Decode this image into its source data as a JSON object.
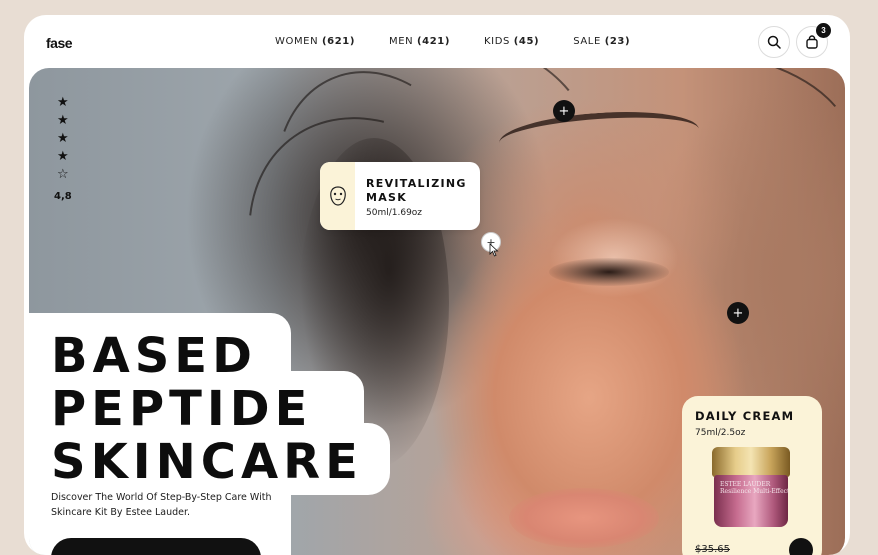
{
  "brand": {
    "logo": "fase"
  },
  "nav": [
    {
      "label": "WOMEN",
      "count": "(621)"
    },
    {
      "label": "MEN",
      "count": "(421)"
    },
    {
      "label": "KIDS",
      "count": "(45)"
    },
    {
      "label": "SALE",
      "count": "(23)"
    }
  ],
  "header": {
    "cart_count": "3",
    "search_icon": "search-icon",
    "cart_icon": "bag-icon"
  },
  "rating": {
    "value": "4,8",
    "stars_filled": 4,
    "stars_total": 5
  },
  "hotspots": {
    "plus": "+"
  },
  "mask_card": {
    "title_line1": "REVITALIZING",
    "title_line2": "MASK",
    "size": "50ml/1.69oz",
    "icon": "face-mask-icon"
  },
  "hero": {
    "headline_line1": "BASED",
    "headline_line2": "PEPTIDE",
    "headline_line3": "SKINCARE",
    "description": "Discover The World Of Step-By-Step Care With Skincare Kit By Estee Lauder."
  },
  "cream_card": {
    "title": "DAILY CREAM",
    "size": "75ml/2.5oz",
    "product_brand": "ESTEE LAUDER",
    "product_name": "Resilience Multi-Effect",
    "price": "$35.65"
  },
  "colors": {
    "accent_card": "#fbf3d8",
    "dark": "#111111",
    "background": "#e8ddd3"
  }
}
